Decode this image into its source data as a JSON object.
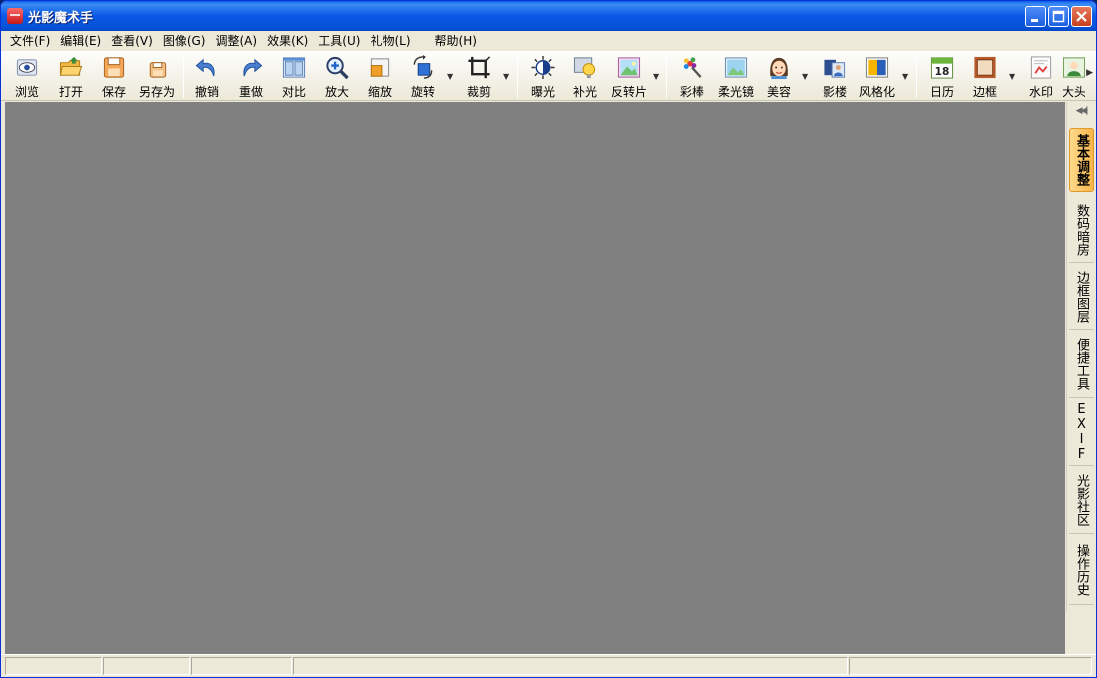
{
  "window": {
    "title": "光影魔术手"
  },
  "menu": [
    "文件(F)",
    "编辑(E)",
    "查看(V)",
    "图像(G)",
    "调整(A)",
    "效果(K)",
    "工具(U)",
    "礼物(L)",
    "帮助(H)"
  ],
  "toolbar": {
    "browse": "浏览",
    "open": "打开",
    "save": "保存",
    "save_as": "另存为",
    "undo": "撤销",
    "redo": "重做",
    "compare": "对比",
    "zoom_in": "放大",
    "zoom_out": "缩放",
    "rotate": "旋转",
    "crop": "裁剪",
    "exposure": "曝光",
    "fill_light": "补光",
    "reversal": "反转片",
    "color_pen": "彩棒",
    "soft_focus": "柔光镜",
    "beauty": "美容",
    "studio": "影楼",
    "stylize": "风格化",
    "calendar": "日历",
    "border": "边框",
    "watermark": "水印",
    "big_head": "大头"
  },
  "calendar_day": "18",
  "right_panel": {
    "tabs": [
      "基本调整",
      "数码暗房",
      "边框图层",
      "便捷工具",
      "EXIF",
      "光影社区",
      "操作历史"
    ],
    "active_tab": "基本调整"
  },
  "status": [
    "",
    "",
    "",
    "",
    ""
  ],
  "colors": {
    "workspace": "#808080",
    "titlebar": "#0a58e6",
    "active_tab": "#f7b54a"
  }
}
